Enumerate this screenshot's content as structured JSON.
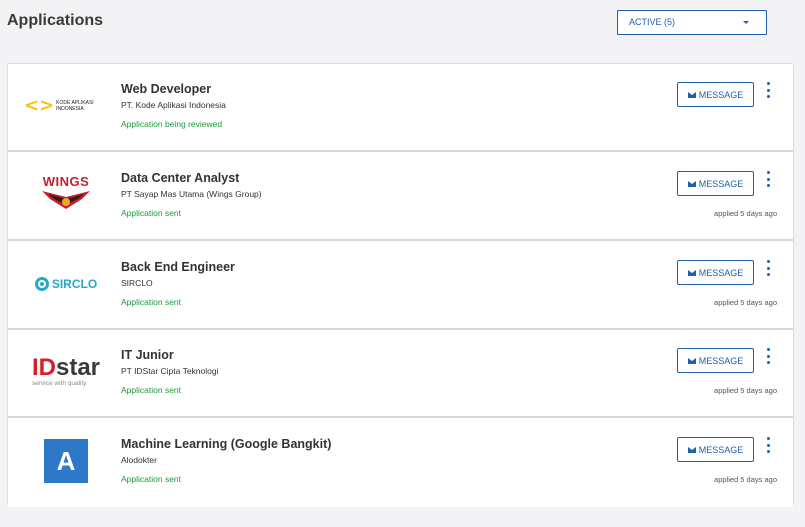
{
  "header": {
    "title": "Applications",
    "filter_value": "ACTIVE (5)"
  },
  "accent_color": "#1f5fae",
  "status_color": "#1a9b3c",
  "applications": [
    {
      "title": "Web Developer",
      "company": "PT. Kode Aplikasi Indonesia",
      "status": "Application being reviewed",
      "applied": "",
      "logo_text": "KODE APLIKASI INDONESIA",
      "logo_glyph": "<>"
    },
    {
      "title": "Data Center Analyst",
      "company": "PT Sayap Mas Utama (Wings Group)",
      "status": "Application sent",
      "applied": "applied 5 days ago",
      "logo_text": "WINGS"
    },
    {
      "title": "Back End Engineer",
      "company": "SIRCLO",
      "status": "Application sent",
      "applied": "applied 5 days ago",
      "logo_text": "SIRCLO"
    },
    {
      "title": "IT Junior",
      "company": "PT IDStar Cipta Teknologi",
      "status": "Application sent",
      "applied": "applied 5 days ago",
      "logo_text_id": "ID",
      "logo_text_star": "star",
      "logo_tagline": "service with quality"
    },
    {
      "title": "Machine Learning (Google Bangkit)",
      "company": "Alodokter",
      "status": "Application sent",
      "applied": "applied 5 days ago",
      "logo_text": "A"
    }
  ],
  "message_label": "MESSAGE",
  "icons": {
    "message": "mail-icon",
    "more": "more-vertical-icon",
    "dropdown": "caret-down-icon"
  }
}
